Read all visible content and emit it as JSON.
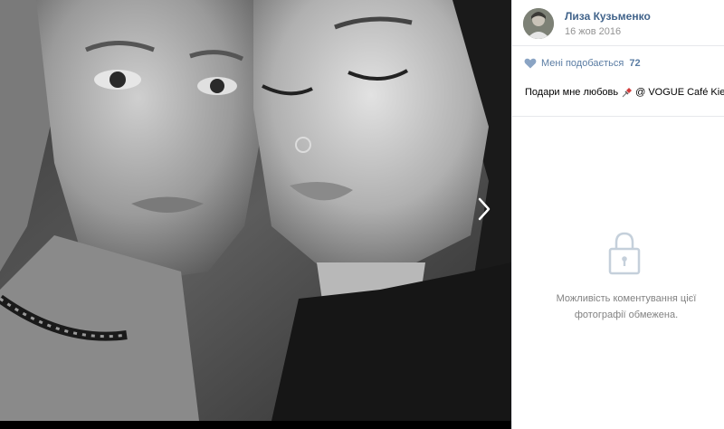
{
  "post": {
    "author_name": "Лиза Кузьменко",
    "date": "16 жов 2016",
    "likes_label": "Мені подобається",
    "likes_count": "72",
    "caption_before": "Подари мне любовь",
    "caption_after": "@ VOGUE Café Kiev"
  },
  "comments": {
    "restricted_line1": "Можливість коментування цієї",
    "restricted_line2": "фотографії обмежена."
  },
  "icons": {
    "like": "heart-icon",
    "next": "chevron-right-icon",
    "lock": "lock-icon",
    "pin": "pushpin-icon"
  },
  "colors": {
    "link": "#42648b",
    "like": "#5a7ca3",
    "muted": "#939393",
    "lock": "#c5d0db"
  }
}
